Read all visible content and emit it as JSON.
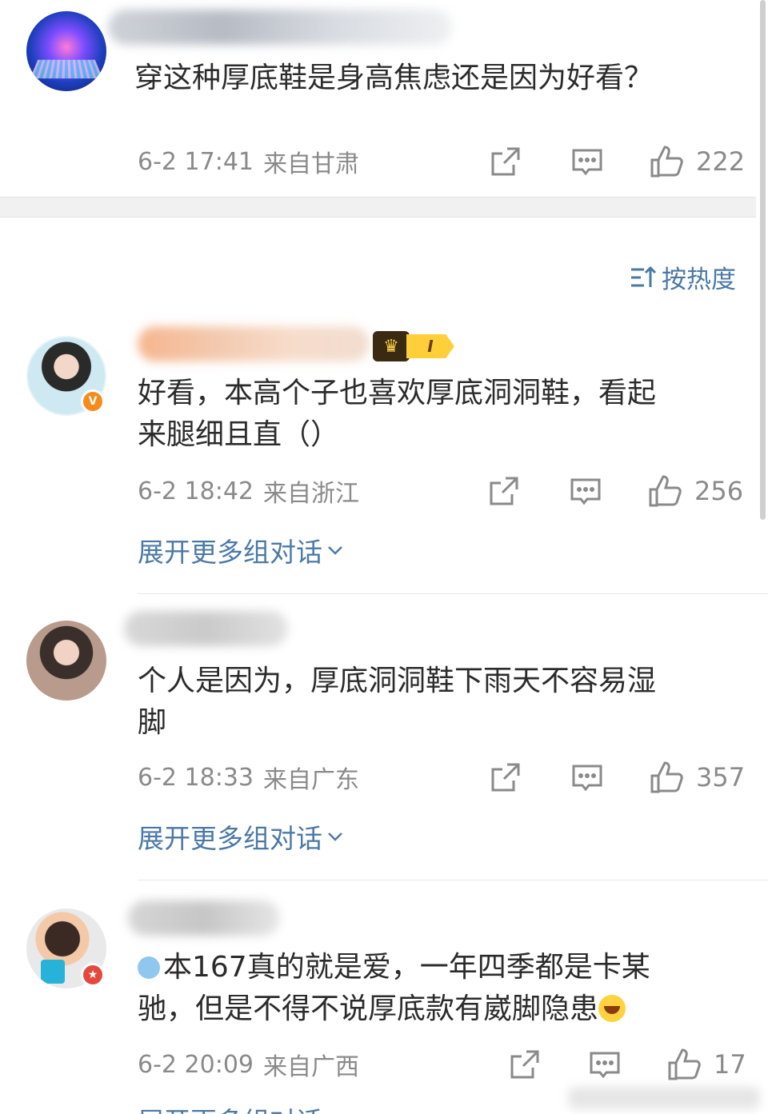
{
  "sort": {
    "label": "按热度"
  },
  "comments": [
    {
      "text": "穿这种厚底鞋是身高焦虑还是因为好看？",
      "time": "6-2 17:41",
      "location": "来自甘肃",
      "likes": "222"
    },
    {
      "text_line1": "好看，本高个子也喜欢厚底洞洞鞋，看起",
      "text_line2": "来腿细且直（）",
      "vip_level": "I",
      "time": "6-2 18:42",
      "location": "来自浙江",
      "likes": "256",
      "expand": "展开更多组对话"
    },
    {
      "text_line1": "个人是因为，厚底洞洞鞋下雨天不容易湿",
      "text_line2": "脚",
      "time": "6-2 18:33",
      "location": "来自广东",
      "likes": "357",
      "expand": "展开更多组对话"
    },
    {
      "text_line1": "本167真的就是爱，一年四季都是卡某",
      "text_line2": "驰，但是不得不说厚底款有崴脚隐患",
      "time": "6-2 20:09",
      "location": "来自广西",
      "likes": "17",
      "expand": "展开更多组对话"
    }
  ],
  "colors": {
    "link": "#4b79a6",
    "meta": "#8a8a8a",
    "text": "#2b2b2b"
  }
}
